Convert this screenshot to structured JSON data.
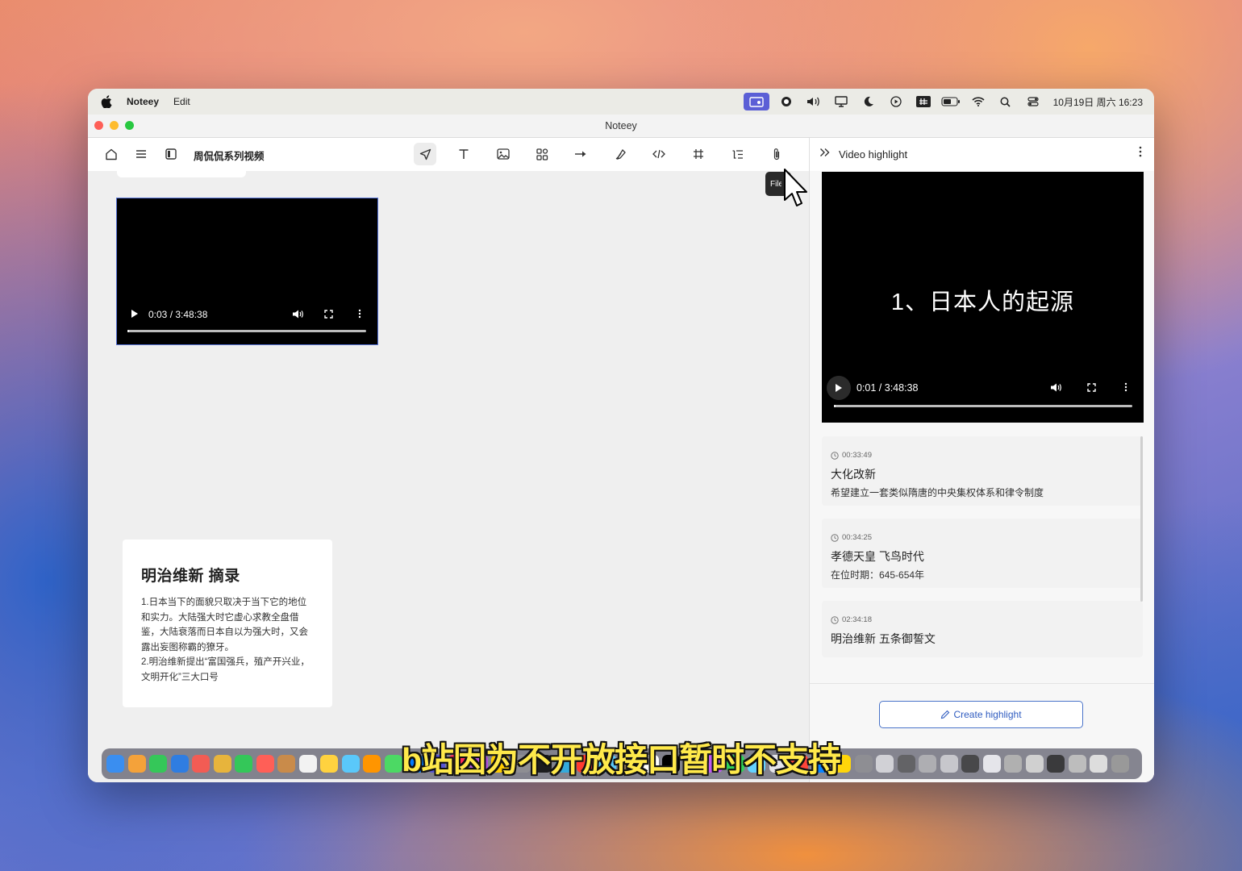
{
  "menubar": {
    "app_name": "Noteey",
    "menu_edit": "Edit",
    "clock": "10月19日 周六  16:23",
    "status_icons": [
      "screen-share-icon",
      "record-icon",
      "volume-icon",
      "display-icon",
      "moon-icon",
      "play-circle-icon",
      "input-method-icon",
      "battery-icon",
      "wifi-icon",
      "search-icon",
      "control-center-icon"
    ]
  },
  "window": {
    "title": "Noteey"
  },
  "toolbar": {
    "doc_title": "周侃侃系列视频",
    "tools": [
      "select-tool-icon",
      "text-tool-icon",
      "image-tool-icon",
      "shapes-tool-icon",
      "arrow-tool-icon",
      "pen-tool-icon",
      "embed-tool-icon",
      "frame-tool-icon",
      "list-tool-icon",
      "file-tool-icon"
    ],
    "tooltip": "File"
  },
  "canvas": {
    "video_small": {
      "time": "0:03 / 3:48:38",
      "progress": 0.0002
    },
    "note": {
      "title": "明治维新 摘录",
      "body": "1.日本当下的面貌只取决于当下它的地位和实力。大陆强大时它虚心求教全盘借鉴，大陆衰落而日本自以为强大时，又会露出妄图称霸的獠牙。\n2.明治维新提出“富国强兵，殖产开兴业，文明开化”三大口号"
    }
  },
  "sidebar": {
    "title": "Video highlight",
    "video": {
      "caption": "1、日本人的起源",
      "time": "0:01 / 3:48:38",
      "progress": 0.0001
    },
    "highlights": [
      {
        "time": "00:33:49",
        "title": "大化改新",
        "desc": "希望建立一套类似隋唐的中央集权体系和律令制度"
      },
      {
        "time": "00:34:25",
        "title": "孝德天皇  飞鸟时代",
        "desc": "在位时期：645-654年"
      },
      {
        "time": "02:34:18",
        "title": "明治维新 五条御誓文",
        "desc": ""
      }
    ],
    "create_button": "Create highlight"
  },
  "subtitle": "b站因为不开放接口暂时不支持",
  "colors": {
    "accent": "#4a73c9",
    "selection": "#5572d8",
    "subtitle": "#ffe94a"
  }
}
